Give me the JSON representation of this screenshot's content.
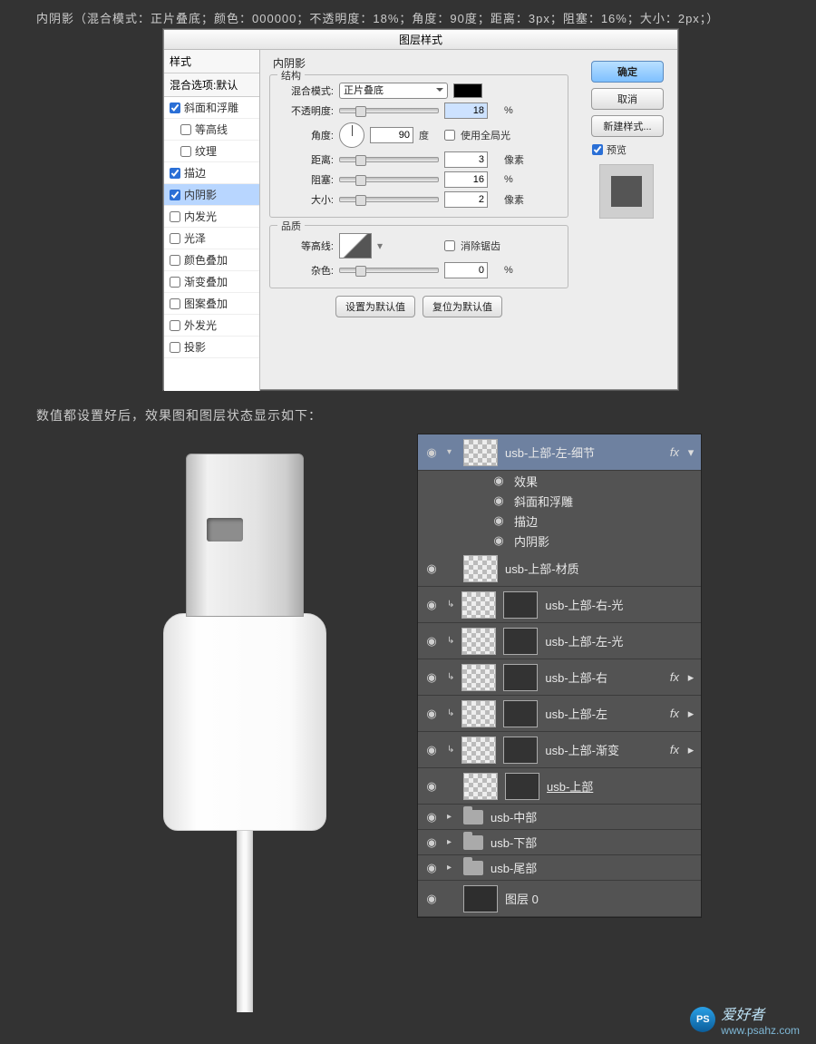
{
  "top_desc": "内阴影（混合模式：正片叠底；颜色：000000；不透明度：18%；角度：90度；距离：3px；阻塞：16%；大小：2px；）",
  "dialog": {
    "title": "图层样式",
    "left": {
      "header": "样式",
      "option_default": "混合选项:默认",
      "items": [
        {
          "label": "斜面和浮雕",
          "checked": true
        },
        {
          "label": "等高线",
          "checked": false,
          "indent": true
        },
        {
          "label": "纹理",
          "checked": false,
          "indent": true
        },
        {
          "label": "描边",
          "checked": true
        },
        {
          "label": "内阴影",
          "checked": true,
          "selected": true
        },
        {
          "label": "内发光",
          "checked": false
        },
        {
          "label": "光泽",
          "checked": false
        },
        {
          "label": "颜色叠加",
          "checked": false
        },
        {
          "label": "渐变叠加",
          "checked": false
        },
        {
          "label": "图案叠加",
          "checked": false
        },
        {
          "label": "外发光",
          "checked": false
        },
        {
          "label": "投影",
          "checked": false
        }
      ]
    },
    "group_inner_shadow": "内阴影",
    "group_structure": "结构",
    "blend_mode_label": "混合模式:",
    "blend_mode_value": "正片叠底",
    "opacity_label": "不透明度:",
    "opacity_value": "18",
    "percent": "%",
    "angle_label": "角度:",
    "angle_value": "90",
    "degree": "度",
    "global_light": "使用全局光",
    "distance_label": "距离:",
    "distance_value": "3",
    "px": "像素",
    "choke_label": "阻塞:",
    "choke_value": "16",
    "size_label": "大小:",
    "size_value": "2",
    "group_quality": "品质",
    "contour_label": "等高线:",
    "antialias": "消除锯齿",
    "noise_label": "杂色:",
    "noise_value": "0",
    "set_default": "设置为默认值",
    "reset_default": "复位为默认值",
    "ok": "确定",
    "cancel": "取消",
    "new_style": "新建样式...",
    "preview": "预览"
  },
  "sub_desc": "数值都设置好后，效果图和图层状态显示如下：",
  "layers": {
    "selected": "usb-上部-左-细节",
    "fx_label": "效果",
    "fx_sub": [
      "斜面和浮雕",
      "描边",
      "内阴影"
    ],
    "rows": [
      {
        "name": "usb-上部-材质",
        "fx": false,
        "clip": false
      },
      {
        "name": "usb-上部-右-光",
        "fx": false,
        "clip": true
      },
      {
        "name": "usb-上部-左-光",
        "fx": false,
        "clip": true
      },
      {
        "name": "usb-上部-右",
        "fx": true,
        "clip": true
      },
      {
        "name": "usb-上部-左",
        "fx": true,
        "clip": true
      },
      {
        "name": "usb-上部-渐变",
        "fx": true,
        "clip": true
      }
    ],
    "linked": "usb-上部",
    "groups": [
      "usb-中部",
      "usb-下部",
      "usb-尾部"
    ],
    "bg": "图层 0",
    "fx_tag": "fx",
    "arrow": "▾"
  },
  "watermark": {
    "logo": "PS",
    "text": "爱好者",
    "url": "www.psahz.com"
  }
}
